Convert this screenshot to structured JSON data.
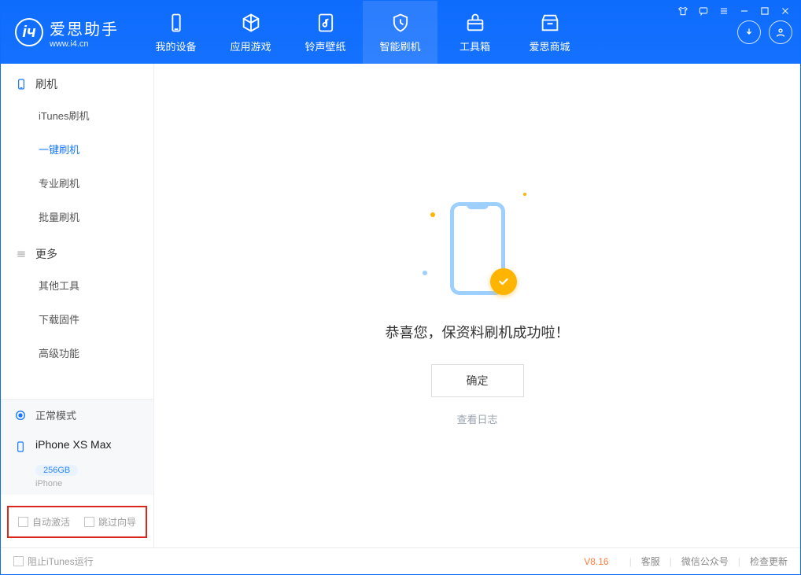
{
  "app": {
    "title": "爱思助手",
    "subtitle": "www.i4.cn"
  },
  "nav": {
    "tabs": [
      {
        "label": "我的设备",
        "icon": "device"
      },
      {
        "label": "应用游戏",
        "icon": "cube"
      },
      {
        "label": "铃声壁纸",
        "icon": "music"
      },
      {
        "label": "智能刷机",
        "icon": "shield"
      },
      {
        "label": "工具箱",
        "icon": "toolbox"
      },
      {
        "label": "爱思商城",
        "icon": "store"
      }
    ],
    "active_index": 3
  },
  "sidebar": {
    "groups": [
      {
        "header": "刷机",
        "icon": "phone",
        "items": [
          "iTunes刷机",
          "一键刷机",
          "专业刷机",
          "批量刷机"
        ],
        "active_index": 1
      },
      {
        "header": "更多",
        "icon": "more",
        "items": [
          "其他工具",
          "下载固件",
          "高级功能"
        ],
        "active_index": -1
      }
    ],
    "mode_label": "正常模式",
    "device": {
      "name": "iPhone XS Max",
      "storage": "256GB",
      "type": "iPhone"
    },
    "options": {
      "auto_activate": "自动激活",
      "skip_guide": "跳过向导"
    }
  },
  "main": {
    "success_text": "恭喜您，保资料刷机成功啦！",
    "ok_label": "确定",
    "log_link_label": "查看日志"
  },
  "statusbar": {
    "block_itunes": "阻止iTunes运行",
    "version": "V8.16",
    "links": [
      "客服",
      "微信公众号",
      "检查更新"
    ]
  }
}
